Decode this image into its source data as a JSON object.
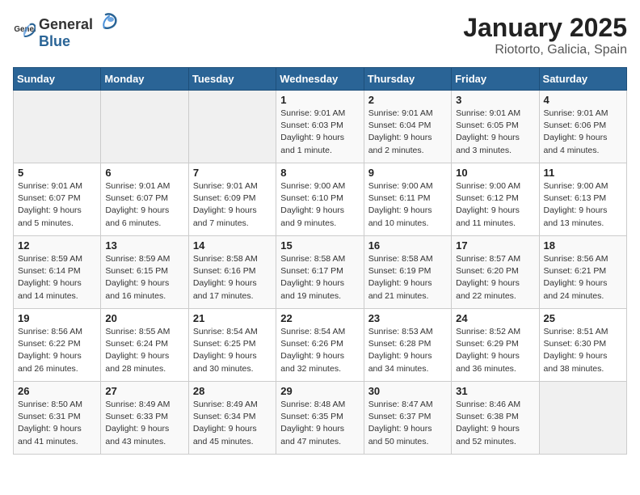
{
  "header": {
    "logo_general": "General",
    "logo_blue": "Blue",
    "month_title": "January 2025",
    "location": "Riotorto, Galicia, Spain"
  },
  "days_of_week": [
    "Sunday",
    "Monday",
    "Tuesday",
    "Wednesday",
    "Thursday",
    "Friday",
    "Saturday"
  ],
  "weeks": [
    [
      {
        "day": "",
        "content": ""
      },
      {
        "day": "",
        "content": ""
      },
      {
        "day": "",
        "content": ""
      },
      {
        "day": "1",
        "content": "Sunrise: 9:01 AM\nSunset: 6:03 PM\nDaylight: 9 hours\nand 1 minute."
      },
      {
        "day": "2",
        "content": "Sunrise: 9:01 AM\nSunset: 6:04 PM\nDaylight: 9 hours\nand 2 minutes."
      },
      {
        "day": "3",
        "content": "Sunrise: 9:01 AM\nSunset: 6:05 PM\nDaylight: 9 hours\nand 3 minutes."
      },
      {
        "day": "4",
        "content": "Sunrise: 9:01 AM\nSunset: 6:06 PM\nDaylight: 9 hours\nand 4 minutes."
      }
    ],
    [
      {
        "day": "5",
        "content": "Sunrise: 9:01 AM\nSunset: 6:07 PM\nDaylight: 9 hours\nand 5 minutes."
      },
      {
        "day": "6",
        "content": "Sunrise: 9:01 AM\nSunset: 6:07 PM\nDaylight: 9 hours\nand 6 minutes."
      },
      {
        "day": "7",
        "content": "Sunrise: 9:01 AM\nSunset: 6:09 PM\nDaylight: 9 hours\nand 7 minutes."
      },
      {
        "day": "8",
        "content": "Sunrise: 9:00 AM\nSunset: 6:10 PM\nDaylight: 9 hours\nand 9 minutes."
      },
      {
        "day": "9",
        "content": "Sunrise: 9:00 AM\nSunset: 6:11 PM\nDaylight: 9 hours\nand 10 minutes."
      },
      {
        "day": "10",
        "content": "Sunrise: 9:00 AM\nSunset: 6:12 PM\nDaylight: 9 hours\nand 11 minutes."
      },
      {
        "day": "11",
        "content": "Sunrise: 9:00 AM\nSunset: 6:13 PM\nDaylight: 9 hours\nand 13 minutes."
      }
    ],
    [
      {
        "day": "12",
        "content": "Sunrise: 8:59 AM\nSunset: 6:14 PM\nDaylight: 9 hours\nand 14 minutes."
      },
      {
        "day": "13",
        "content": "Sunrise: 8:59 AM\nSunset: 6:15 PM\nDaylight: 9 hours\nand 16 minutes."
      },
      {
        "day": "14",
        "content": "Sunrise: 8:58 AM\nSunset: 6:16 PM\nDaylight: 9 hours\nand 17 minutes."
      },
      {
        "day": "15",
        "content": "Sunrise: 8:58 AM\nSunset: 6:17 PM\nDaylight: 9 hours\nand 19 minutes."
      },
      {
        "day": "16",
        "content": "Sunrise: 8:58 AM\nSunset: 6:19 PM\nDaylight: 9 hours\nand 21 minutes."
      },
      {
        "day": "17",
        "content": "Sunrise: 8:57 AM\nSunset: 6:20 PM\nDaylight: 9 hours\nand 22 minutes."
      },
      {
        "day": "18",
        "content": "Sunrise: 8:56 AM\nSunset: 6:21 PM\nDaylight: 9 hours\nand 24 minutes."
      }
    ],
    [
      {
        "day": "19",
        "content": "Sunrise: 8:56 AM\nSunset: 6:22 PM\nDaylight: 9 hours\nand 26 minutes."
      },
      {
        "day": "20",
        "content": "Sunrise: 8:55 AM\nSunset: 6:24 PM\nDaylight: 9 hours\nand 28 minutes."
      },
      {
        "day": "21",
        "content": "Sunrise: 8:54 AM\nSunset: 6:25 PM\nDaylight: 9 hours\nand 30 minutes."
      },
      {
        "day": "22",
        "content": "Sunrise: 8:54 AM\nSunset: 6:26 PM\nDaylight: 9 hours\nand 32 minutes."
      },
      {
        "day": "23",
        "content": "Sunrise: 8:53 AM\nSunset: 6:28 PM\nDaylight: 9 hours\nand 34 minutes."
      },
      {
        "day": "24",
        "content": "Sunrise: 8:52 AM\nSunset: 6:29 PM\nDaylight: 9 hours\nand 36 minutes."
      },
      {
        "day": "25",
        "content": "Sunrise: 8:51 AM\nSunset: 6:30 PM\nDaylight: 9 hours\nand 38 minutes."
      }
    ],
    [
      {
        "day": "26",
        "content": "Sunrise: 8:50 AM\nSunset: 6:31 PM\nDaylight: 9 hours\nand 41 minutes."
      },
      {
        "day": "27",
        "content": "Sunrise: 8:49 AM\nSunset: 6:33 PM\nDaylight: 9 hours\nand 43 minutes."
      },
      {
        "day": "28",
        "content": "Sunrise: 8:49 AM\nSunset: 6:34 PM\nDaylight: 9 hours\nand 45 minutes."
      },
      {
        "day": "29",
        "content": "Sunrise: 8:48 AM\nSunset: 6:35 PM\nDaylight: 9 hours\nand 47 minutes."
      },
      {
        "day": "30",
        "content": "Sunrise: 8:47 AM\nSunset: 6:37 PM\nDaylight: 9 hours\nand 50 minutes."
      },
      {
        "day": "31",
        "content": "Sunrise: 8:46 AM\nSunset: 6:38 PM\nDaylight: 9 hours\nand 52 minutes."
      },
      {
        "day": "",
        "content": ""
      }
    ]
  ]
}
